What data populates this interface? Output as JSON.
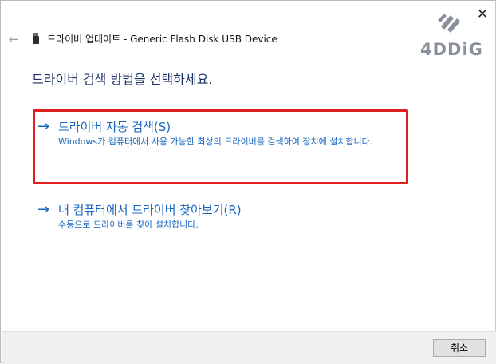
{
  "window": {
    "title": "드라이버 업데이트 - Generic Flash Disk USB Device",
    "back_icon": "arrow-left-icon",
    "close_icon": "close-icon",
    "device_icon": "usb-drive-icon"
  },
  "logo": {
    "text": "4DDiG",
    "icon": "4ddig-logo-mark",
    "color": "#8a9099"
  },
  "heading": "드라이버 검색 방법을 선택하세요.",
  "options": [
    {
      "arrow": "→",
      "title": "드라이버 자동 검색(S)",
      "description": "Windows가 컴퓨터에서 사용 가능한 최상의 드라이버를 검색하여 장치에 설치합니다.",
      "highlighted": true
    },
    {
      "arrow": "→",
      "title": "내 컴퓨터에서 드라이버 찾아보기(R)",
      "description": "수동으로 드라이버를 찾아 설치합니다.",
      "highlighted": false
    }
  ],
  "footer": {
    "cancel_label": "취소"
  },
  "colors": {
    "link": "#1565c0",
    "heading": "#1a3266",
    "highlight_border": "#e0201f"
  }
}
